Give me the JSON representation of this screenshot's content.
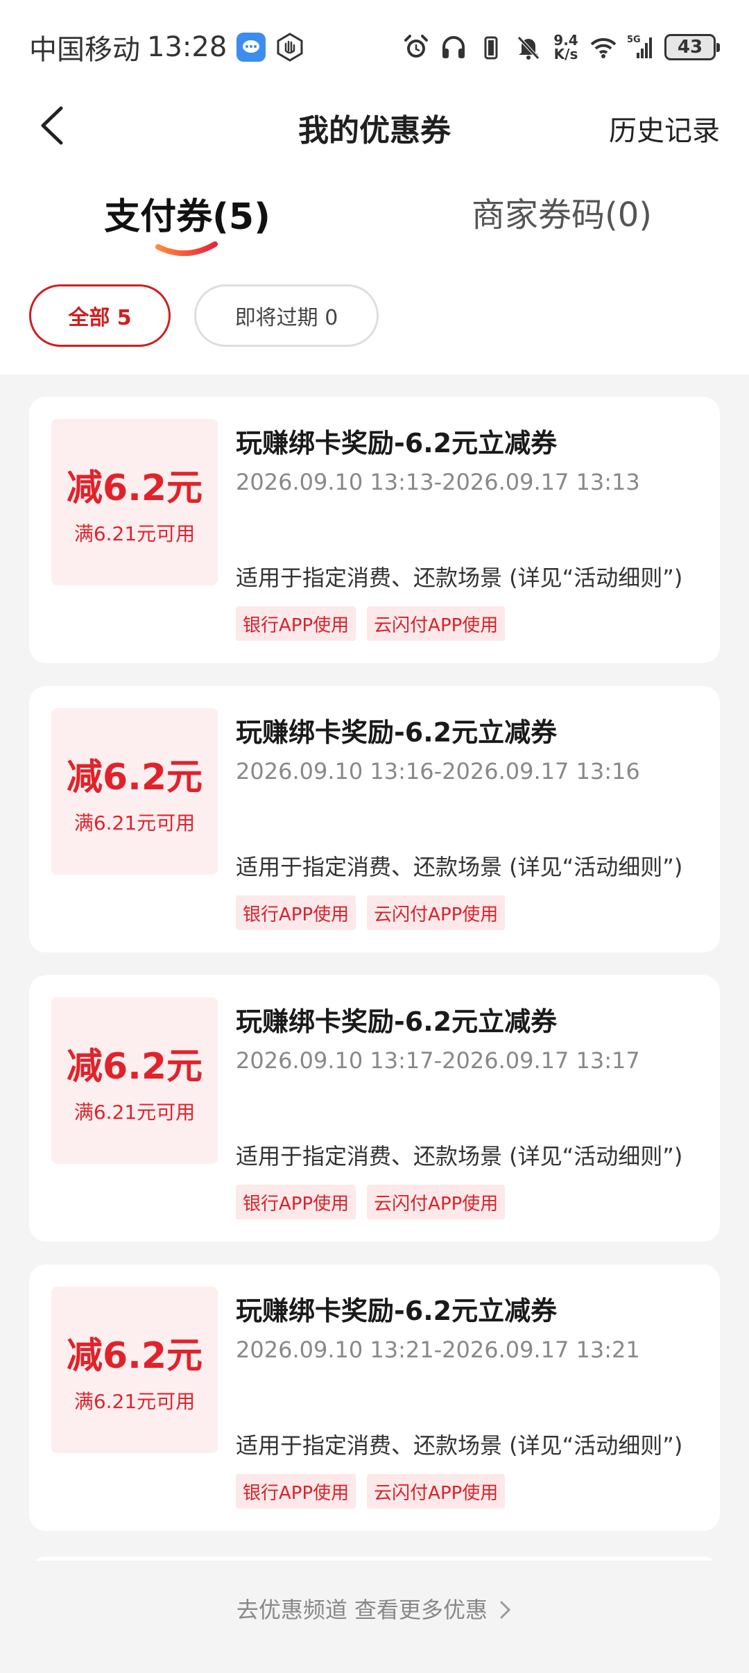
{
  "status_bar": {
    "carrier": "中国移动",
    "time": "13:28",
    "net_speed_value": "9.4",
    "net_speed_unit": "K/s",
    "network": "5G",
    "battery": "43"
  },
  "nav": {
    "title": "我的优惠券",
    "history": "历史记录"
  },
  "tabs": [
    {
      "label": "支付券(5)",
      "active": true
    },
    {
      "label": "商家券码(0)",
      "active": false
    }
  ],
  "filters": [
    {
      "label": "全部 5",
      "active": true
    },
    {
      "label": "即将过期 0",
      "active": false
    }
  ],
  "coupons": [
    {
      "amount": "减6.2元",
      "threshold": "满6.21元可用",
      "title": "玩赚绑卡奖励-6.2元立减券",
      "period": "2026.09.10 13:13-2026.09.17 13:13",
      "scope": "适用于指定消费、还款场景 (详见“活动细则”)",
      "tags": [
        "银行APP使用",
        "云闪付APP使用"
      ]
    },
    {
      "amount": "减6.2元",
      "threshold": "满6.21元可用",
      "title": "玩赚绑卡奖励-6.2元立减券",
      "period": "2026.09.10 13:16-2026.09.17 13:16",
      "scope": "适用于指定消费、还款场景 (详见“活动细则”)",
      "tags": [
        "银行APP使用",
        "云闪付APP使用"
      ]
    },
    {
      "amount": "减6.2元",
      "threshold": "满6.21元可用",
      "title": "玩赚绑卡奖励-6.2元立减券",
      "period": "2026.09.10 13:17-2026.09.17 13:17",
      "scope": "适用于指定消费、还款场景 (详见“活动细则”)",
      "tags": [
        "银行APP使用",
        "云闪付APP使用"
      ]
    },
    {
      "amount": "减6.2元",
      "threshold": "满6.21元可用",
      "title": "玩赚绑卡奖励-6.2元立减券",
      "period": "2026.09.10 13:21-2026.09.17 13:21",
      "scope": "适用于指定消费、还款场景 (详见“活动细则”)",
      "tags": [
        "银行APP使用",
        "云闪付APP使用"
      ]
    }
  ],
  "footer": {
    "more_link": "去优惠频道 查看更多优惠"
  },
  "colors": {
    "accent": "#e0232b",
    "coupon_bg": "#fdeff0",
    "page_bg": "#f4f4f4"
  },
  "icons": [
    "message-app-icon",
    "hand-app-icon",
    "alarm-icon",
    "headphones-icon",
    "vibrate-icon",
    "mute-bell-icon",
    "wifi-icon",
    "signal-icon",
    "back-arrow-icon",
    "chevron-right-icon"
  ]
}
